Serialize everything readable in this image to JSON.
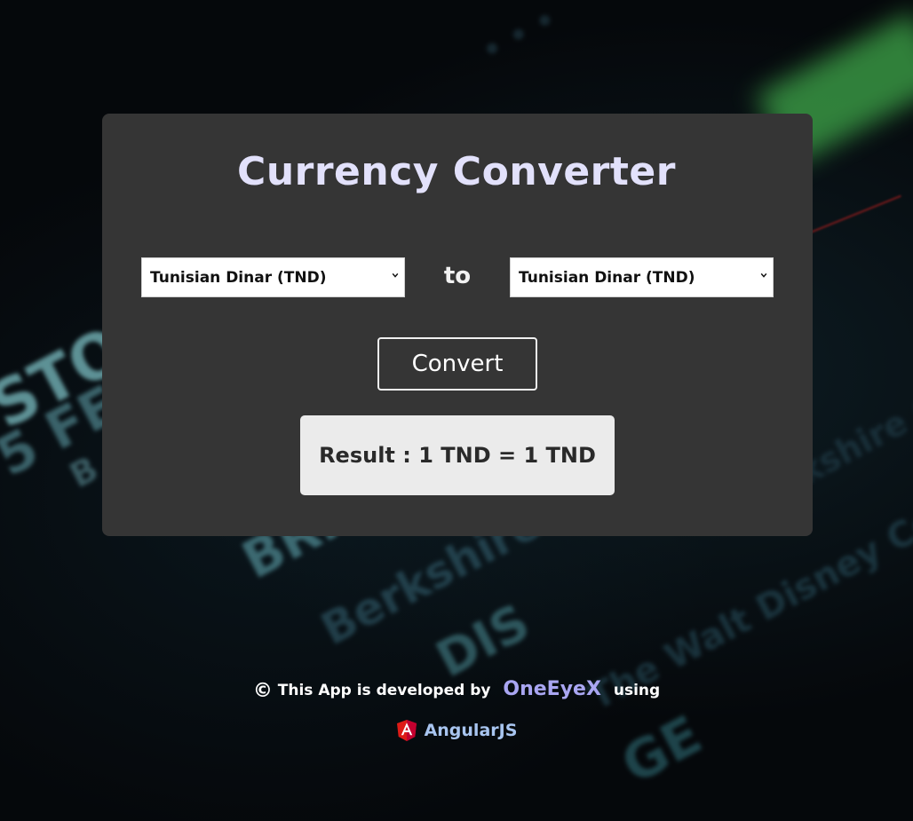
{
  "app": {
    "title": "Currency Converter"
  },
  "converter": {
    "from_currency": "Tunisian Dinar (TND)",
    "to_label": "to",
    "to_currency": "Tunisian Dinar (TND)",
    "convert_label": "Convert",
    "result_text": "Result : 1 TND = 1 TND"
  },
  "footer": {
    "copyright_symbol": "©",
    "developed_by_text": "This App is developed by",
    "author": "OneEyeX",
    "using_text": "using",
    "framework": "AngularJS",
    "framework_icon": "angular-icon"
  },
  "colors": {
    "card_bg": "#353535",
    "title": "#e2e1fb",
    "author_link": "#a9a6f2",
    "framework_link": "#a8c5f0",
    "result_bg": "#ebebeb"
  }
}
